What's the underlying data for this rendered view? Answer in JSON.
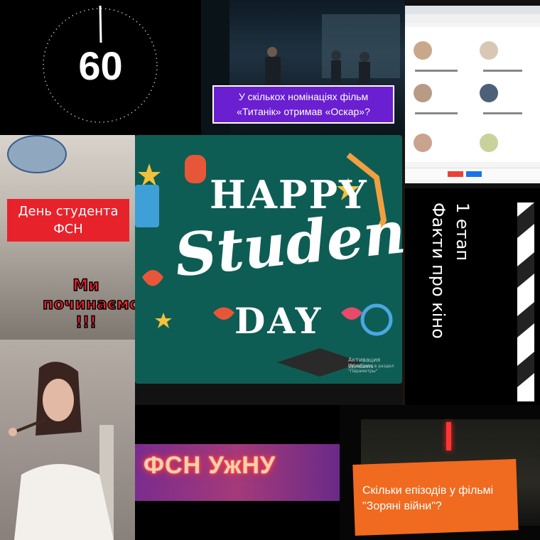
{
  "timer": {
    "value": "60"
  },
  "titanic": {
    "question": "У скількох номінаціях фільм «Титанік»  отримав «Оскар»?"
  },
  "student_day_panel": {
    "title": "День студента ФСН",
    "start_text": "Ми починаємо !!!"
  },
  "center": {
    "happy": "HAPPY",
    "students": "Student's",
    "day": "DAY",
    "activation_title": "Активация Windows",
    "activation_hint": "Перейдите в раздел \"Параметры\""
  },
  "facts_panel": {
    "stage": "1 етап",
    "topic": "Факти про кіно"
  },
  "neon": {
    "text": "ФСН УжНУ"
  },
  "star_wars": {
    "question": "Скільки епізодів у фільмі \"Зоряні війни\"?"
  },
  "colors": {
    "purple_box": "#6a1fd0",
    "red_band": "#e8222b",
    "orange_brush": "#f06a1f",
    "chalkboard": "#0e5d55"
  }
}
